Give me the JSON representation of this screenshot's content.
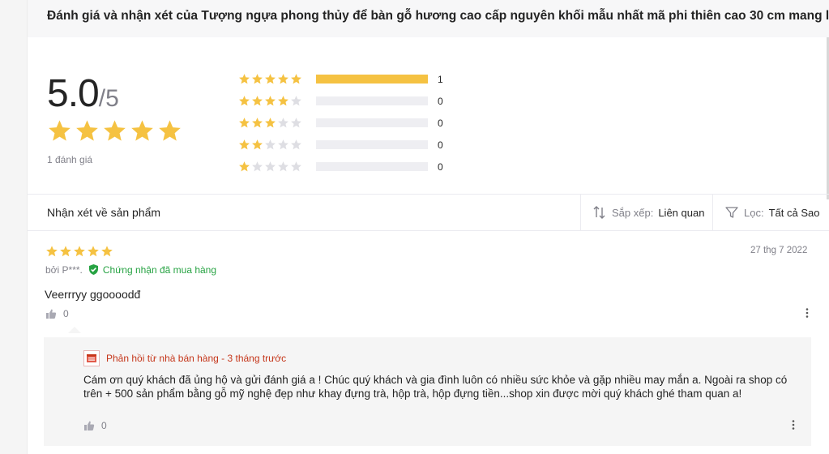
{
  "title": "Đánh giá và nhận xét của Tượng ngựa phong thủy để bàn gỗ hương cao cấp nguyên khối mẫu nhất mã phi thiên cao 30 cm mang l...",
  "summary": {
    "score": "5.0",
    "max": "/5",
    "stars": 5,
    "count_label": "1 đánh giá",
    "distribution": [
      {
        "stars": 5,
        "count": "1",
        "fraction": 1.0
      },
      {
        "stars": 4,
        "count": "0",
        "fraction": 0
      },
      {
        "stars": 3,
        "count": "0",
        "fraction": 0
      },
      {
        "stars": 2,
        "count": "0",
        "fraction": 0
      },
      {
        "stars": 1,
        "count": "0",
        "fraction": 0
      }
    ]
  },
  "filter": {
    "title": "Nhận xét về sản phẩm",
    "sort_label": "Sắp xếp:",
    "sort_value": "Liên quan",
    "filter_label": "Lọc:",
    "filter_value": "Tất cả Sao"
  },
  "review": {
    "stars": 5,
    "date": "27 thg 7 2022",
    "author": "bởi P***.",
    "verified": "Chứng nhận đã mua hàng",
    "text": "Veerrryy ggoooodđ",
    "likes": "0",
    "reply": {
      "header": "Phản hồi từ nhà bán hàng - 3 tháng trước",
      "text": "Cám ơn quý khách đã ủng hộ và gửi đánh giá a ! Chúc quý khách và gia đình luôn có nhiều sức khỏe và gặp nhiều may mắn a. Ngoài ra shop có trên + 500 sản phẩm bằng gỗ mỹ nghệ đẹp như khay đựng trà, hộp trà, hộp đựng tiền...shop xin được mời quý khách ghé tham quan a!",
      "likes": "0"
    }
  },
  "colors": {
    "star": "#f5c242",
    "star_empty": "#dedee3",
    "verified": "#27a343",
    "reply_header": "#c5361a"
  }
}
